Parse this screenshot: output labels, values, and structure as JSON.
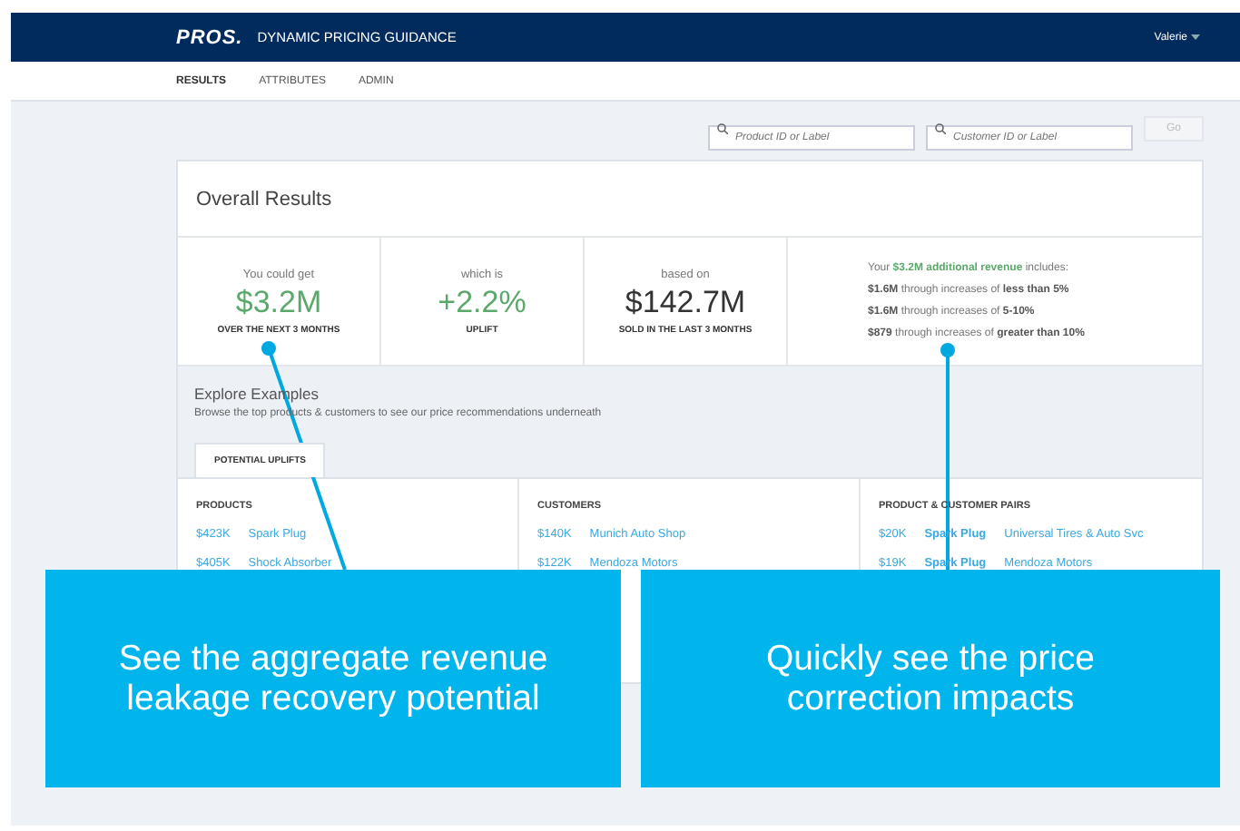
{
  "header": {
    "logo": "PROS.",
    "title": "DYNAMIC PRICING GUIDANCE",
    "user": "Valerie"
  },
  "nav": [
    {
      "label": "RESULTS",
      "selected": true
    },
    {
      "label": "ATTRIBUTES",
      "selected": false
    },
    {
      "label": "ADMIN",
      "selected": false
    }
  ],
  "search": {
    "product_placeholder": "Product ID or Label",
    "customer_placeholder": "Customer ID or Label",
    "button": "Go"
  },
  "overall": {
    "title": "Overall Results",
    "metrics": [
      {
        "caption": "You could get",
        "value": "$3.2M",
        "label": "OVER THE NEXT 3 MONTHS",
        "kind": "positive"
      },
      {
        "caption": "which is",
        "value": "+2.2%",
        "label": "UPLIFT",
        "kind": "positive"
      },
      {
        "caption": "based on",
        "value": "$142.7M",
        "label": "SOLD IN THE LAST 3 MONTHS",
        "kind": "neutral"
      }
    ],
    "breakdown": [
      "Your **$3.2M additional revenue** includes:",
      "**$1.6M** through increases of **less than 5%**",
      "**$1.6M** through increases of **5-10%**",
      "**$879** through increases of **greater than 10%**"
    ]
  },
  "explore": {
    "title": "Explore Examples",
    "subtitle": "Browse the top products & customers to see our price recommendations underneath",
    "tabs": [
      {
        "label": "POTENTIAL UPLIFTS",
        "selected": true
      }
    ],
    "columns": [
      {
        "heading": "PRODUCTS",
        "rows": [
          {
            "amount": "$423K",
            "items": [
              "Spark Plug"
            ]
          },
          {
            "amount": "$405K",
            "items": [
              "Shock Absorber"
            ]
          }
        ]
      },
      {
        "heading": "CUSTOMERS",
        "rows": [
          {
            "amount": "$140K",
            "items": [
              "Munich Auto Shop"
            ]
          },
          {
            "amount": "$122K",
            "items": [
              "Mendoza Motors"
            ]
          }
        ]
      },
      {
        "heading": "PRODUCT & CUSTOMER PAIRS",
        "rows": [
          {
            "amount": "$20K",
            "items": [
              "Spark Plug",
              "Universal Tires & Auto Svc"
            ]
          },
          {
            "amount": "$19K",
            "items": [
              "Spark Plug",
              "Mendoza Motors"
            ]
          }
        ]
      }
    ]
  },
  "callouts": [
    {
      "text": "See the aggregate revenue leakage recovery potential"
    },
    {
      "text": "Quickly see the price correction impacts"
    }
  ]
}
